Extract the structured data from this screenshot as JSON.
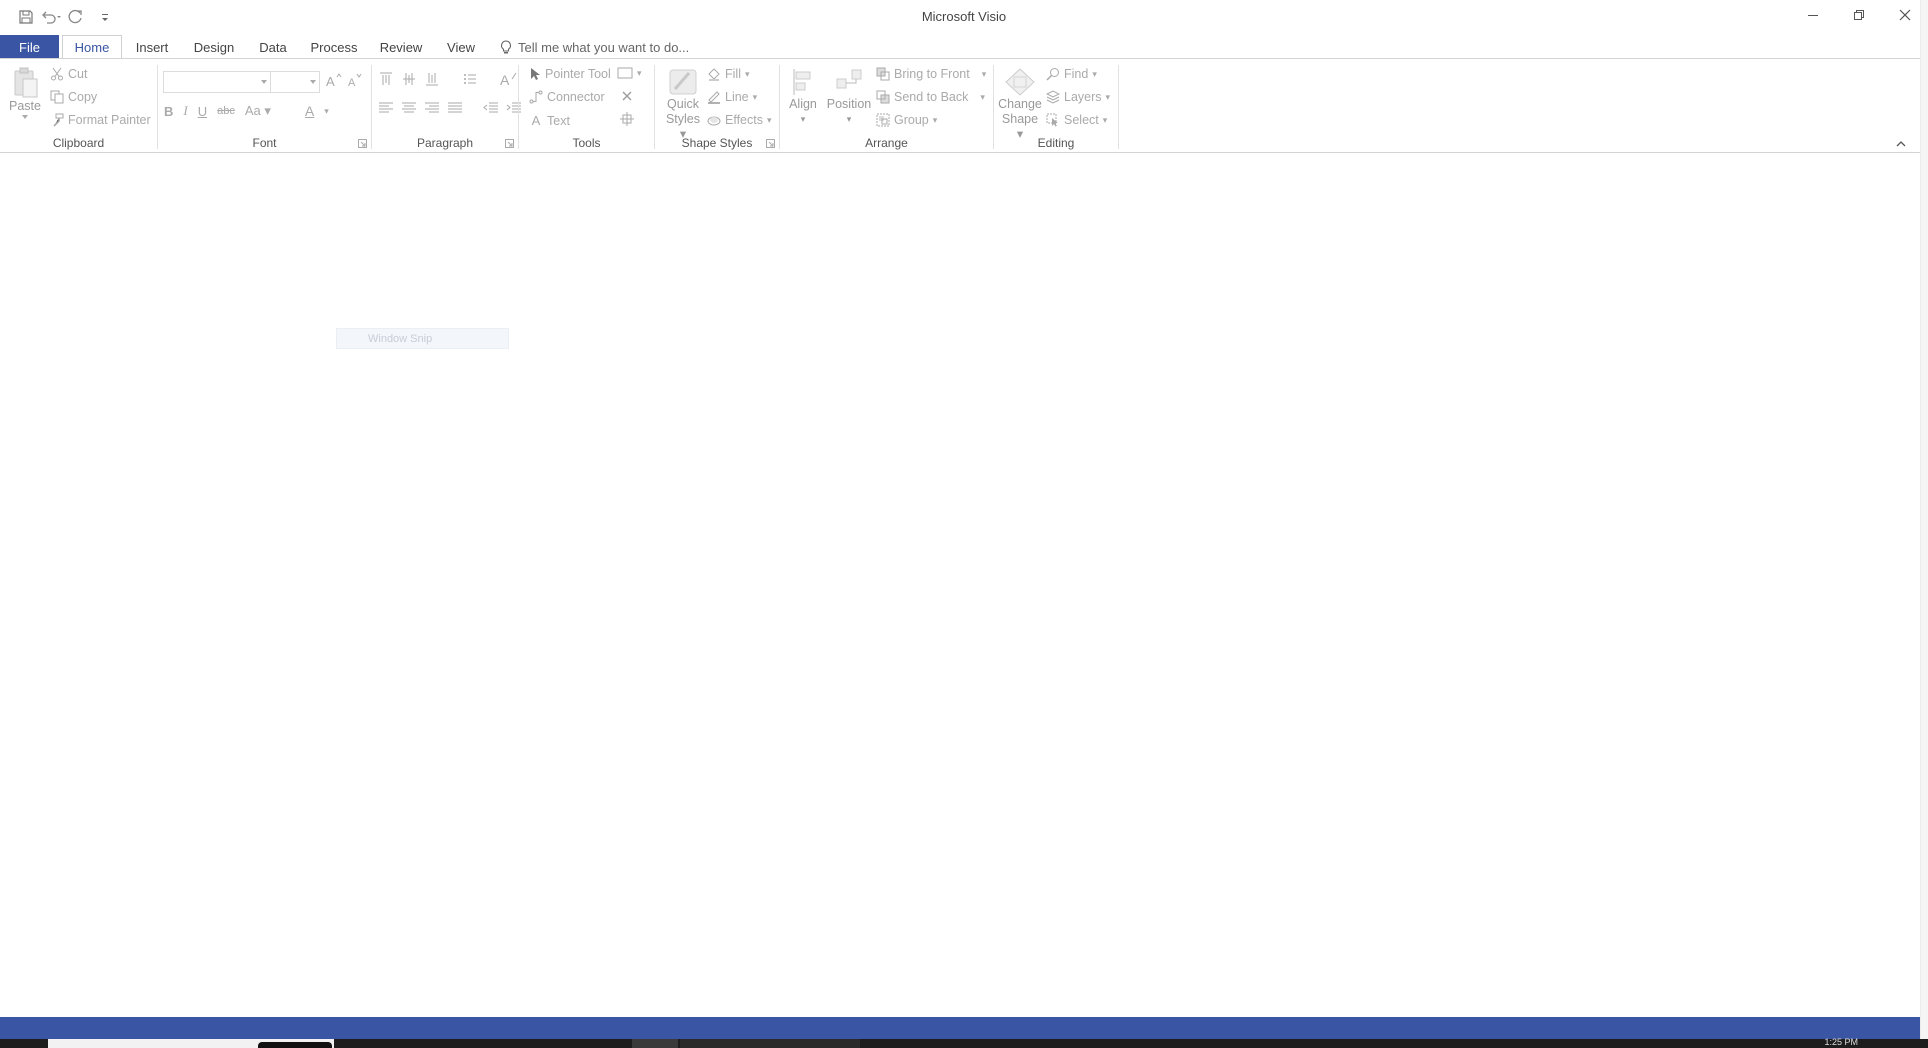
{
  "window": {
    "title": "Microsoft Visio"
  },
  "quick_access": {
    "save_icon": "save-icon",
    "undo_icon": "undo-icon",
    "redo_icon": "redo-icon",
    "customize_icon": "customize-qat-icon"
  },
  "tabs": {
    "file": "File",
    "home": "Home",
    "insert": "Insert",
    "design": "Design",
    "data": "Data",
    "process": "Process",
    "review": "Review",
    "view": "View"
  },
  "tell_me": {
    "placeholder": "Tell me what you want to do..."
  },
  "clipboard": {
    "label": "Clipboard",
    "paste": "Paste",
    "cut": "Cut",
    "copy": "Copy",
    "format_painter": "Format Painter"
  },
  "font": {
    "label": "Font",
    "font_name": "",
    "font_size": "",
    "change_case": "Aa"
  },
  "paragraph": {
    "label": "Paragraph"
  },
  "tools": {
    "label": "Tools",
    "pointer": "Pointer Tool",
    "connector": "Connector",
    "text": "Text"
  },
  "shape_styles": {
    "label": "Shape Styles",
    "quick_styles_line1": "Quick",
    "quick_styles_line2": "Styles",
    "fill": "Fill",
    "line": "Line",
    "effects": "Effects"
  },
  "arrange": {
    "label": "Arrange",
    "align": "Align",
    "position": "Position",
    "bring_to_front": "Bring to Front",
    "send_to_back": "Send to Back",
    "group": "Group"
  },
  "editing": {
    "label": "Editing",
    "change_shape_line1": "Change",
    "change_shape_line2": "Shape",
    "find": "Find",
    "layers": "Layers",
    "select": "Select"
  },
  "overlay": {
    "snip": "Window Snip"
  },
  "taskbar": {
    "clock": "1:25 PM"
  },
  "colors": {
    "accent": "#3955a3",
    "taskbar": "#1d1d1d"
  }
}
